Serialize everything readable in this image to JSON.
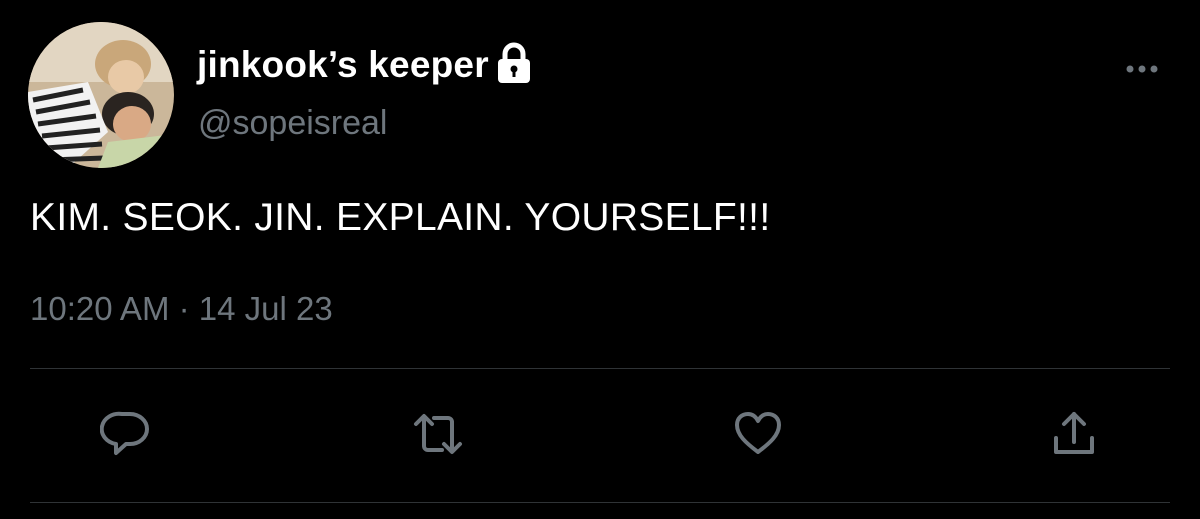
{
  "tweet": {
    "display_name": "jinkook’s keeper",
    "handle": "@sopeisreal",
    "text": "KIM. SEOK. JIN. EXPLAIN. YOURSELF!!!",
    "timestamp": "10:20 AM · 14 Jul 23",
    "protected_icon": "lock-icon",
    "avatar_icon": "profile-photo"
  },
  "actions": [
    {
      "name": "reply",
      "icon": "comment-icon"
    },
    {
      "name": "retweet",
      "icon": "retweet-icon"
    },
    {
      "name": "like",
      "icon": "heart-icon"
    },
    {
      "name": "share",
      "icon": "share-icon"
    }
  ],
  "colors": {
    "background": "#000000",
    "text_primary": "#ffffff",
    "text_secondary": "#6e767d",
    "divider": "#2f3336",
    "icon": "#6e767d"
  }
}
